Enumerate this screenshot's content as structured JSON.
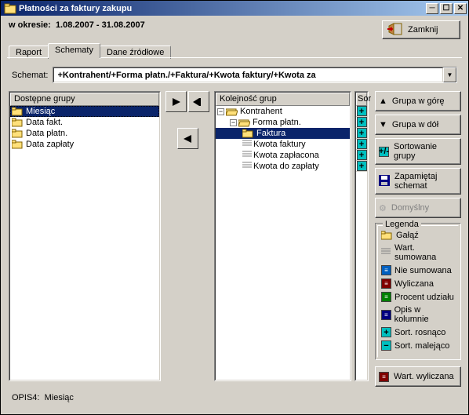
{
  "window": {
    "title": "Płatności za faktury zakupu"
  },
  "period": {
    "label": "w okresie:",
    "value": "1.08.2007 - 31.08.2007"
  },
  "close_btn": "Zamknij",
  "tabs": {
    "report": "Raport",
    "schemes": "Schematy",
    "sources": "Dane źródłowe"
  },
  "schemat": {
    "label": "Schemat:",
    "value": "+Kontrahent/+Forma płatn./+Faktura/+Kwota faktury/+Kwota za"
  },
  "left_panel": {
    "header": "Dostępne grupy",
    "items": [
      "Miesiąc",
      "Data fakt.",
      "Data płatn.",
      "Data zapłaty"
    ]
  },
  "right_panel": {
    "header": "Kolejność grup",
    "sort_header": "Sor",
    "tree": [
      {
        "level": 0,
        "expander": "-",
        "icon": "folder-open",
        "label": "Kontrahent"
      },
      {
        "level": 1,
        "expander": "-",
        "icon": "folder-open",
        "label": "Forma płatn."
      },
      {
        "level": 2,
        "expander": "",
        "icon": "folder",
        "label": "Faktura",
        "selected": true
      },
      {
        "level": 2,
        "expander": "",
        "icon": "lines",
        "label": "Kwota faktury"
      },
      {
        "level": 2,
        "expander": "",
        "icon": "lines",
        "label": "Kwota zapłacona"
      },
      {
        "level": 2,
        "expander": "",
        "icon": "lines",
        "label": "Kwota do zapłaty"
      }
    ]
  },
  "side_buttons": {
    "group_up": "Grupa w górę",
    "group_down": "Grupa w dół",
    "sort_group": "Sortowanie grupy",
    "remember": "Zapamiętaj schemat",
    "domyslny": "Domyślny",
    "wart_wyl": "Wart. wyliczana"
  },
  "legend": {
    "title": "Legenda",
    "items": {
      "galaz": "Gałąź",
      "wart_sum": "Wart. sumowana",
      "nie_sum": "Nie sumowana",
      "wyliczana": "Wyliczana",
      "procent": "Procent udziału",
      "opis": "Opis w kolumnie",
      "sort_rosn": "Sort. rosnąco",
      "sort_mal": "Sort. malejąco"
    }
  },
  "footer": {
    "label": "OPIS4:",
    "value": "Miesiąc"
  },
  "icons": {
    "plus": "+",
    "minus": "−"
  }
}
